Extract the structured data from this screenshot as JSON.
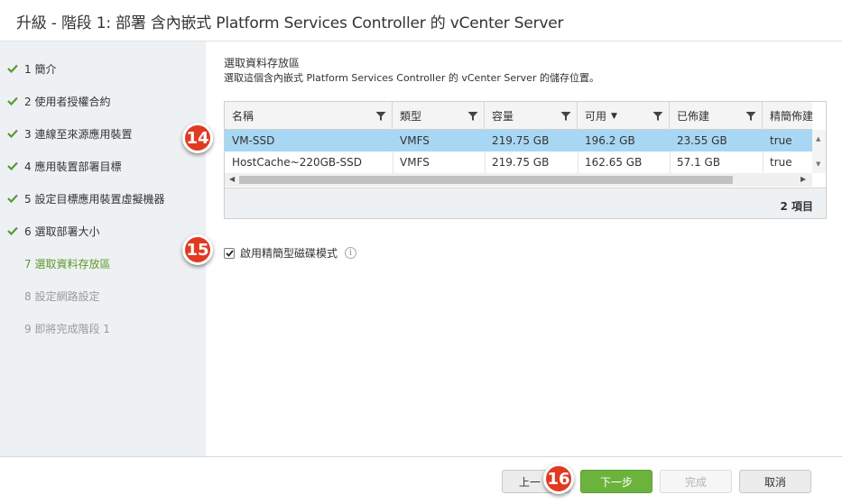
{
  "window": {
    "title": "升級 - 階段 1: 部署 含內嵌式 Platform Services Controller 的 vCenter Server"
  },
  "colors": {
    "accent_green": "#5b9a2c",
    "selected_row": "#a8d7f4",
    "callout_red": "#e13a21",
    "primary_button": "#6cb33e"
  },
  "steps": [
    {
      "label": "1 簡介",
      "state": "done",
      "icon": "check-icon"
    },
    {
      "label": "2 使用者授權合約",
      "state": "done",
      "icon": "check-icon"
    },
    {
      "label": "3 連線至來源應用裝置",
      "state": "done",
      "icon": "check-icon"
    },
    {
      "label": "4 應用裝置部署目標",
      "state": "done",
      "icon": "check-icon"
    },
    {
      "label": "5 設定目標應用裝置虛擬機器",
      "state": "done",
      "icon": "check-icon"
    },
    {
      "label": "6 選取部署大小",
      "state": "done",
      "icon": "check-icon"
    },
    {
      "label": "7 選取資料存放區",
      "state": "current"
    },
    {
      "label": "8 設定網路設定",
      "state": "pending"
    },
    {
      "label": "9 即將完成階段 1",
      "state": "pending"
    }
  ],
  "content": {
    "title": "選取資料存放區",
    "description": "選取這個含內嵌式 Platform Services Controller 的 vCenter Server 的儲存位置。"
  },
  "table": {
    "columns": [
      "名稱",
      "類型",
      "容量",
      "可用",
      "已佈建",
      "精簡佈建"
    ],
    "sort_indicator": "▼",
    "rows": [
      [
        "VM-SSD",
        "VMFS",
        "219.75 GB",
        "196.2 GB",
        "23.55 GB",
        "true"
      ],
      [
        "HostCache~220GB-SSD",
        "VMFS",
        "219.75 GB",
        "162.65 GB",
        "57.1 GB",
        "true"
      ]
    ],
    "selected_row": 0,
    "item_count": "2 項目"
  },
  "thin_disk": {
    "label": "啟用精簡型磁碟模式",
    "checked": true,
    "info": "i"
  },
  "buttons": {
    "back": "上一",
    "next": "下一步",
    "finish": "完成",
    "cancel": "取消"
  },
  "callouts": [
    "14",
    "15",
    "16"
  ]
}
